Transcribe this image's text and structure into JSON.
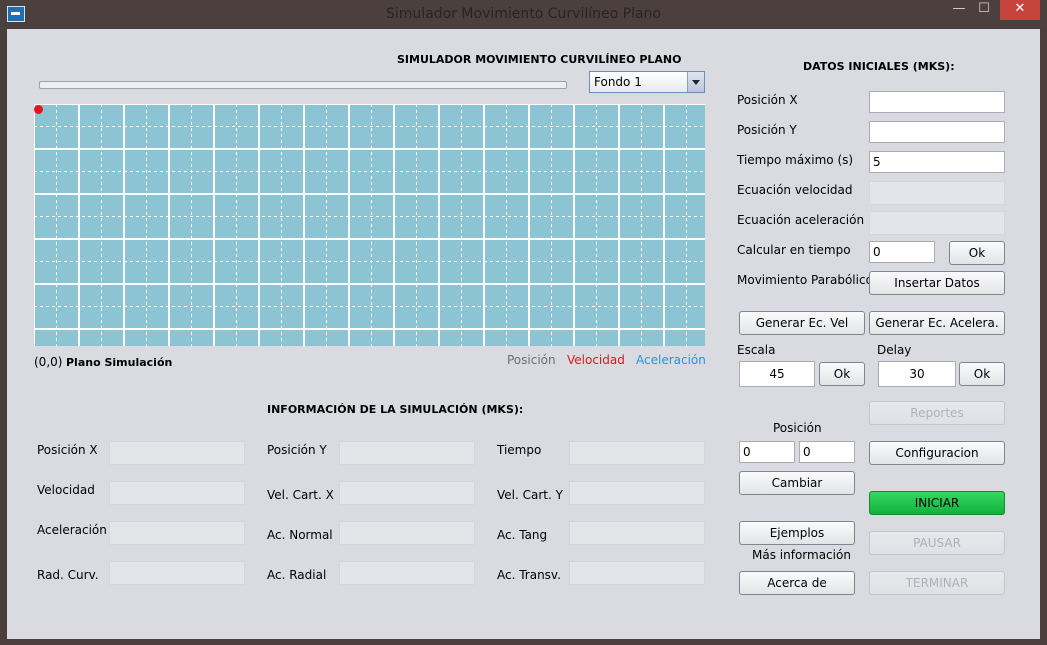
{
  "window": {
    "title": "Simulador Movimiento Curvilíneo Plano",
    "min": "—",
    "max": "☐",
    "close": "✕"
  },
  "left": {
    "heading": "SIMULADOR MOVIMIENTO CURVILÍNEO PLANO",
    "combo_value": "Fondo 1",
    "origin_label": "(0,0)",
    "plane_label": "Plano Simulación",
    "legend": {
      "pos": "Posición",
      "vel": "Velocidad",
      "acc": "Aceleración"
    },
    "info_heading": "INFORMACIÓN DE LA SIMULACIÓN (MKS):",
    "info": {
      "pos_x": "Posición X",
      "pos_y": "Posición Y",
      "tiempo": "Tiempo",
      "velocidad": "Velocidad",
      "vel_x": "Vel. Cart. X",
      "vel_y": "Vel. Cart. Y",
      "aceleracion": "Aceleración",
      "ac_normal": "Ac. Normal",
      "ac_tang": "Ac. Tang",
      "rad_curv": "Rad. Curv.",
      "ac_radial": "Ac. Radial",
      "ac_transv": "Ac. Transv."
    }
  },
  "right": {
    "heading": "DATOS INICIALES (MKS):",
    "pos_x_label": "Posición X",
    "pos_y_label": "Posición Y",
    "tmax_label": "Tiempo máximo (s)",
    "tmax_value": "5",
    "ec_vel_label": "Ecuación velocidad",
    "ec_acc_label": "Ecuación aceleración",
    "calc_label": "Calcular en tiempo",
    "calc_value": "0",
    "ok": "Ok",
    "parab_label": "Movimiento Parabólico",
    "insertar": "Insertar Datos",
    "gen_vel": "Generar Ec. Vel",
    "gen_acc": "Generar Ec. Acelera.",
    "escala_label": "Escala",
    "escala_value": "45",
    "delay_label": "Delay",
    "delay_value": "30",
    "reportes": "Reportes",
    "posicion_label": "Posición",
    "pos_a": "0",
    "pos_b": "0",
    "configuracion": "Configuracion",
    "cambiar": "Cambiar",
    "iniciar": "INICIAR",
    "ejemplos": "Ejemplos",
    "mas_info": "Más información",
    "pausar": "PAUSAR",
    "acerca": "Acerca de",
    "terminar": "TERMINAR"
  },
  "colors": {
    "sim_background": "#8cc4d3",
    "start_button": "#1ec34c",
    "velocity": "#e8131d",
    "acceleration": "#2397d8"
  }
}
